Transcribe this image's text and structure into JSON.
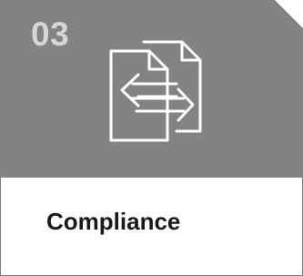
{
  "card": {
    "number": "03",
    "title": "Compliance",
    "icon": "document-exchange-icon",
    "colors": {
      "header_background": "#838383",
      "number_text": "#d6d6d6",
      "icon_stroke": "#ffffff",
      "body_background": "#ffffff",
      "border": "#7d7d7d",
      "title_text": "#1a1a1a"
    }
  }
}
